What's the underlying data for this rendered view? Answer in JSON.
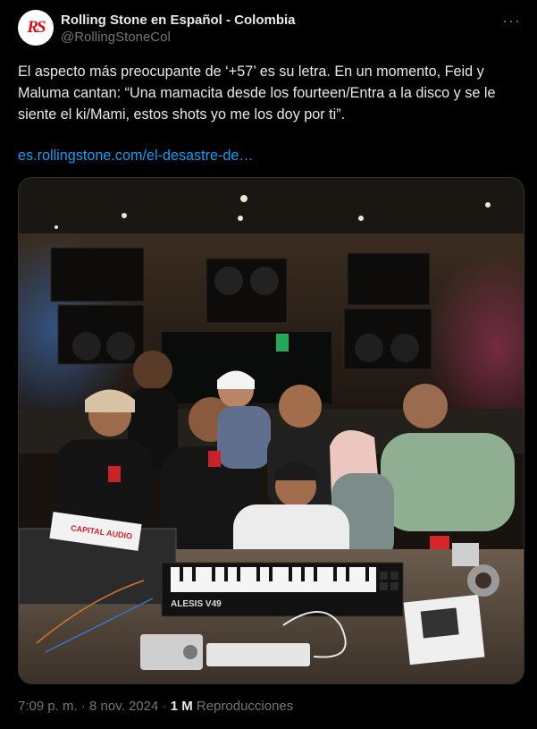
{
  "account": {
    "display_name": "Rolling Stone en Español - Colombia",
    "handle": "@RollingStoneCol",
    "avatar_text": "RS",
    "brand_color": "#d1141b"
  },
  "icons": {
    "more": "more-dots-icon"
  },
  "tweet": {
    "text": "El aspecto más preocupante de ‘+57’ es su letra. En un momento, Feid y Maluma cantan: “Una mamacita desde los fourteen/Entra a la disco y se le siente el ki/Mami, estos shots yo me los doy por ti”.",
    "link_text": "es.rollingstone.com/el-desastre-de…"
  },
  "media": {
    "capital_audio_label": "CAPITAL AUDIO",
    "keyboard_label": "ALESIS V49"
  },
  "meta": {
    "time": "7:09 p. m.",
    "separator": "·",
    "date": "8 nov. 2024",
    "views_count": "1 M",
    "views_label": "Reproducciones"
  },
  "colors": {
    "link": "#1d9bf0",
    "text": "#e7e9ea",
    "muted": "#71767b",
    "background": "#000000"
  }
}
